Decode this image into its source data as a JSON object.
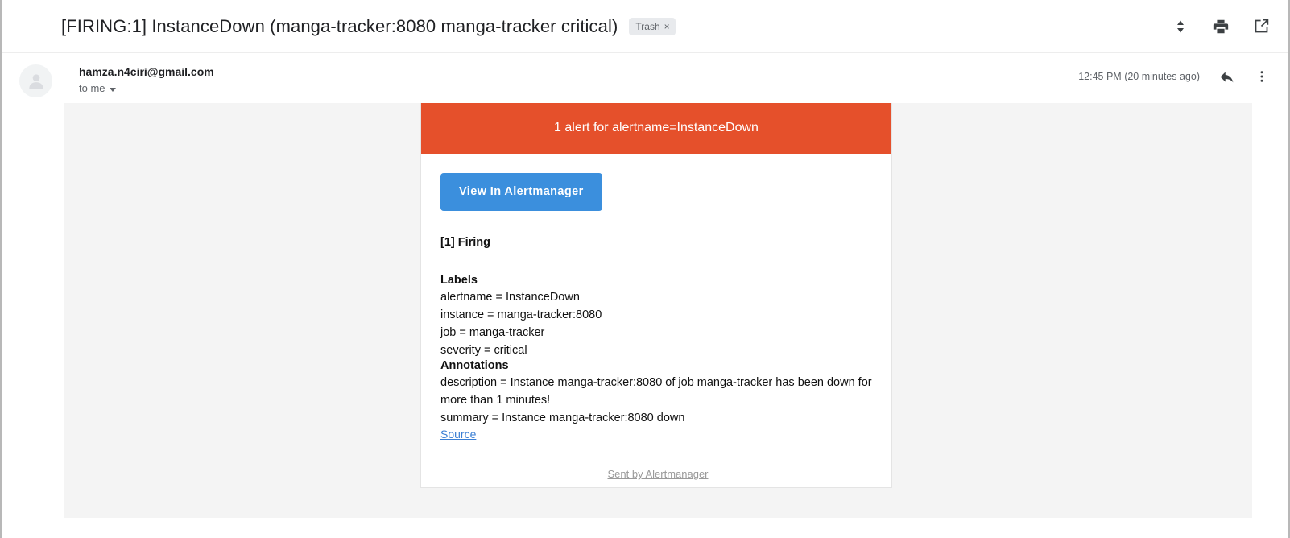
{
  "header": {
    "subject": "[FIRING:1] InstanceDown (manga-tracker:8080 manga-tracker critical)",
    "label_chip": "Trash",
    "label_chip_close": "×",
    "icons": [
      "expand-collapse-icon",
      "print-icon",
      "open-in-new-window-icon"
    ]
  },
  "message": {
    "sender": "hamza.n4ciri@gmail.com",
    "recipient": "to me",
    "timestamp": "12:45 PM (20 minutes ago)",
    "reply_icon": "reply-icon",
    "more_icon": "more-vertical-icon",
    "avatar_icon": "person-avatar-icon"
  },
  "alert": {
    "banner_text": "1 alert for alertname=InstanceDown",
    "banner_color": "#e5502b",
    "button_label": "View In Alertmanager",
    "button_color": "#3b8fdd",
    "firing_header": "[1] Firing",
    "labels_header": "Labels",
    "labels": [
      "alertname = InstanceDown",
      "instance = manga-tracker:8080",
      "job = manga-tracker",
      "severity = critical"
    ],
    "annotations_header": "Annotations",
    "annotations": [
      "description = Instance manga-tracker:8080 of job manga-tracker has been down for more than 1 minutes!",
      "summary = Instance manga-tracker:8080 down"
    ],
    "source_link": "Source",
    "link_color": "#3b7fd4"
  },
  "footer": {
    "sent_by": "Sent by Alertmanager"
  }
}
